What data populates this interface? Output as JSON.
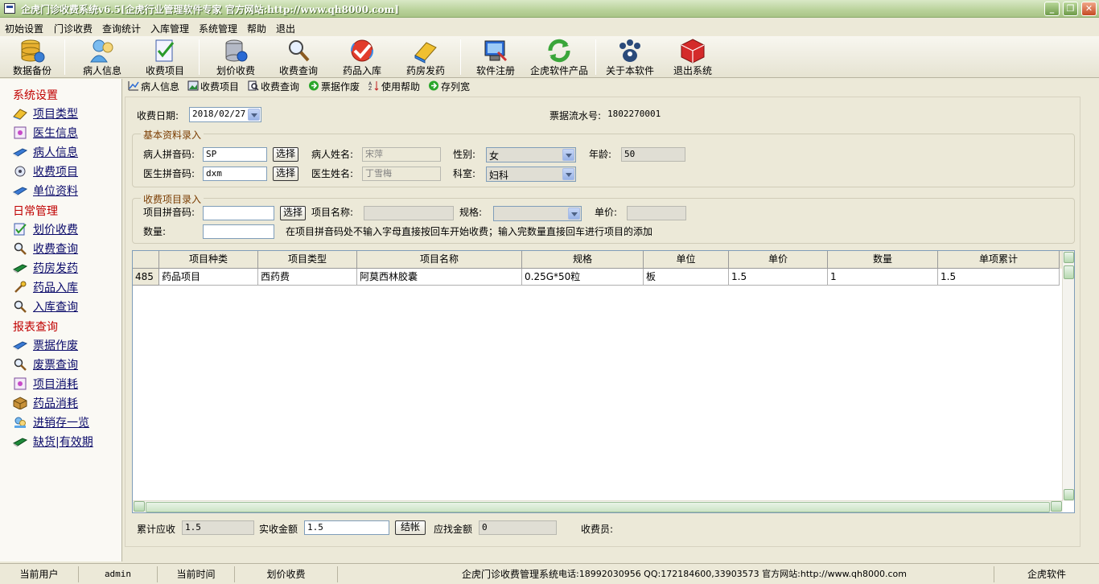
{
  "window": {
    "title": "企虎门诊收费系统v6.5[企虎行业管理软件专家 官方网站:http://www.qh8000.com]"
  },
  "menu": [
    "初始设置",
    "门诊收费",
    "查询统计",
    "入库管理",
    "系统管理",
    "帮助",
    "退出"
  ],
  "toolbar": [
    {
      "label": "数据备份",
      "icon": "database-backup-icon"
    },
    {
      "label": "病人信息",
      "icon": "patient-info-icon"
    },
    {
      "label": "收费项目",
      "icon": "charge-item-icon"
    },
    {
      "label": "划价收费",
      "icon": "pricing-charge-icon"
    },
    {
      "label": "收费查询",
      "icon": "charge-query-icon"
    },
    {
      "label": "药品入库",
      "icon": "drug-stock-in-icon"
    },
    {
      "label": "药房发药",
      "icon": "pharmacy-dispense-icon"
    },
    {
      "label": "软件注册",
      "icon": "software-register-icon"
    },
    {
      "label": "企虎软件产品",
      "icon": "products-icon"
    },
    {
      "label": "关于本软件",
      "icon": "about-icon"
    },
    {
      "label": "退出系统",
      "icon": "exit-icon"
    }
  ],
  "sidebar": {
    "sections": [
      {
        "title": "系统设置",
        "items": [
          "项目类型",
          "医生信息",
          "病人信息",
          "收费项目",
          "单位资料"
        ]
      },
      {
        "title": "日常管理",
        "items": [
          "划价收费",
          "收费查询",
          "药房发药",
          "药品入库",
          "入库查询"
        ]
      },
      {
        "title": "报表查询",
        "items": [
          "票据作废",
          "废票查询",
          "项目消耗",
          "药品消耗",
          "进销存一览",
          "缺货|有效期"
        ]
      }
    ]
  },
  "subtoolbar": [
    "病人信息",
    "收费项目",
    "收费查询",
    "票据作废",
    "使用帮助",
    "存列宽"
  ],
  "form": {
    "charge_date_label": "收费日期:",
    "charge_date": "2018/02/27",
    "receipt_no_label": "票据流水号:",
    "receipt_no": "1802270001",
    "basic_title": "基本资料录入",
    "patient_py_label": "病人拼音码:",
    "patient_py": "SP",
    "select_label": "选择",
    "patient_name_label": "病人姓名:",
    "patient_name": "宋萍",
    "gender_label": "性别:",
    "gender": "女",
    "age_label": "年龄:",
    "age": "50",
    "doctor_py_label": "医生拼音码:",
    "doctor_py": "dxm",
    "doctor_name_label": "医生姓名:",
    "doctor_name": "丁雪梅",
    "dept_label": "科室:",
    "dept": "妇科",
    "item_title": "收费项目录入",
    "item_py_label": "项目拼音码:",
    "item_py": "",
    "item_name_label": "项目名称:",
    "item_name": "",
    "spec_label": "规格:",
    "spec": "",
    "price_label": "单价:",
    "price": "",
    "qty_label": "数量:",
    "qty": "",
    "hint": "在项目拼音码处不输入字母直接按回车开始收费；输入完数量直接回车进行项目的添加"
  },
  "grid": {
    "columns": [
      "项目种类",
      "项目类型",
      "项目名称",
      "规格",
      "单位",
      "单价",
      "数量",
      "单项累计"
    ],
    "rows": [
      {
        "no": "485",
        "cells": [
          "药品项目",
          "西药费",
          "阿莫西林胶囊",
          "0.25G*50粒",
          "板",
          "1.5",
          "1",
          "1.5"
        ]
      }
    ]
  },
  "footer": {
    "total_label": "累计应收",
    "total": "1.5",
    "paid_label": "实收金额",
    "paid": "1.5",
    "settle_label": "结帐",
    "change_label": "应找金额",
    "change": "0",
    "cashier_label": "收费员:"
  },
  "status": {
    "user_label": "当前用户",
    "user": "admin",
    "time_label": "当前时间",
    "module": "划价收费",
    "system": "企虎门诊收费管理系统",
    "contact": "电话:18992030956 QQ:172184600,33903573  官方网站:http://www.qh8000.com",
    "brand": "企虎软件"
  }
}
